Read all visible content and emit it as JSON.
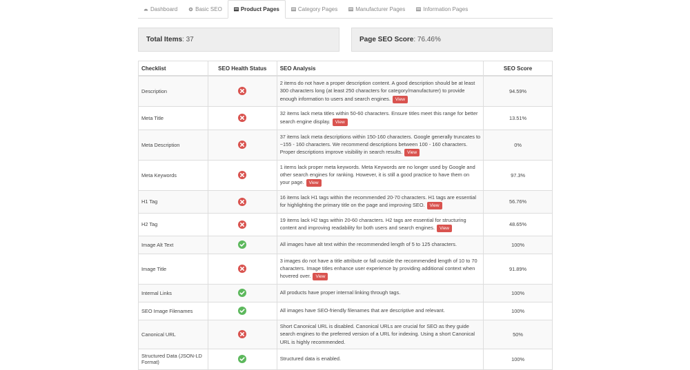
{
  "tabs": [
    {
      "label": "Dashboard",
      "icon": "dashboard-icon"
    },
    {
      "label": "Basic SEO",
      "icon": "gear-icon"
    },
    {
      "label": "Product Pages",
      "icon": "product-icon",
      "active": true
    },
    {
      "label": "Category Pages",
      "icon": "category-icon"
    },
    {
      "label": "Manufacturer Pages",
      "icon": "manufacturer-icon"
    },
    {
      "label": "Information Pages",
      "icon": "information-icon"
    }
  ],
  "stats": {
    "total_label": "Total Items",
    "total_value": ": 37",
    "score_label": "Page SEO Score",
    "score_value": ": 76.46%"
  },
  "table": {
    "headers": [
      "Checklist",
      "SEO Health Status",
      "SEO Analysis",
      "SEO Score"
    ],
    "view_label": "View",
    "rows": [
      {
        "check": "Description",
        "status": "fail",
        "analysis": "2 items do not have a proper description content. A good description should be at least 300 characters long (at least 250 characters for category/manufacturer) to provide enough information to users and search engines.",
        "view": true,
        "score": "94.59%",
        "h": 44
      },
      {
        "check": "Meta Title",
        "status": "fail",
        "analysis": "32 items lack meta titles within 50-60 characters. Ensure titles meet this range for better search engine display.",
        "view": true,
        "score": "13.51%",
        "h": 34
      },
      {
        "check": "Meta Description",
        "status": "fail",
        "analysis": "37 items lack meta descriptions within 150-160 characters. Google generally truncates to ~155 - 160 characters. We recommend descriptions between 100 - 160 characters. Proper descriptions improve visibility in search results.",
        "view": true,
        "score": "0%",
        "h": 44
      },
      {
        "check": "Meta Keywords",
        "status": "fail",
        "analysis": "1 items lack proper meta keywords. Meta Keywords are no longer used by Google and other search engines for ranking. However, it is still a good practice to have them on your page.",
        "view": true,
        "score": "97.3%",
        "h": 44
      },
      {
        "check": "H1 Tag",
        "status": "fail",
        "analysis": "16 items lack H1 tags within the recommended 20-70 characters. H1 tags are essential for highlighting the primary title on the page and improving SEO.",
        "view": true,
        "score": "56.76%",
        "h": 33
      },
      {
        "check": "H2 Tag",
        "status": "fail",
        "analysis": "19 items lack H2 tags within 20-60 characters. H2 tags are essential for structuring content and improving readability for both users and search engines.",
        "view": true,
        "score": "48.65%",
        "h": 33
      },
      {
        "check": "Image Alt Text",
        "status": "pass",
        "analysis": "All images have alt text within the recommended length of 5 to 125 characters.",
        "view": false,
        "score": "100%",
        "h": 26
      },
      {
        "check": "Image Title",
        "status": "fail",
        "analysis": "3 images do not have a title attribute or fall outside the recommended length of 10 to 70 characters. Image titles enhance user experience by providing additional context when hovered over.",
        "view": true,
        "score": "91.89%",
        "h": 44
      },
      {
        "check": "Internal Links",
        "status": "pass",
        "analysis": "All products have proper internal linking through tags.",
        "view": false,
        "score": "100%",
        "h": 26
      },
      {
        "check": "SEO Image Filenames",
        "status": "pass",
        "analysis": "All images have SEO-friendly filenames that are descriptive and relevant.",
        "view": false,
        "score": "100%",
        "h": 26
      },
      {
        "check": "Canonical URL",
        "status": "fail",
        "analysis": "Short Canonical URL is disabled. Canonical URLs are crucial for SEO as they guide search engines to the preferred version of a URL for indexing. Using a short Canonical URL is highly recommended.",
        "view": false,
        "score": "50%",
        "h": 42
      },
      {
        "check": "Structured Data (JSON-LD Format)",
        "status": "pass",
        "analysis": "Structured data is enabled.",
        "view": false,
        "score": "100%",
        "h": 30
      }
    ]
  },
  "colors": {
    "fail": "#d9534f",
    "pass": "#5cb85c",
    "view_bg": "#d9534f"
  }
}
